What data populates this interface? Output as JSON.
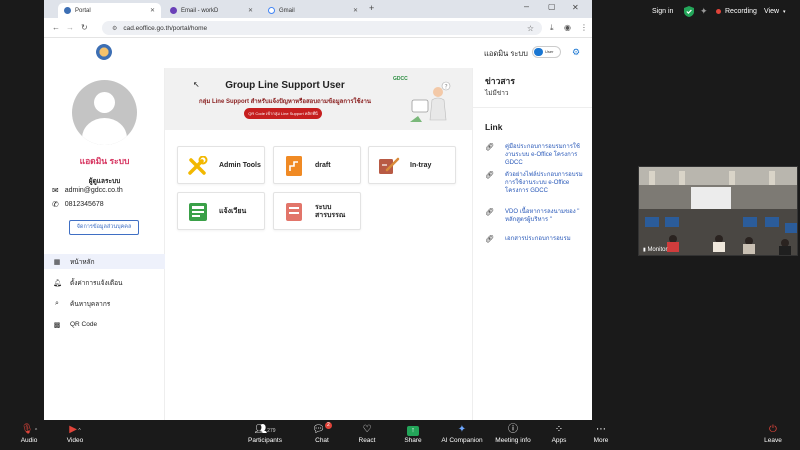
{
  "zoom_top": {
    "sign_in": "Sign in",
    "recording": "Recording",
    "view": "View"
  },
  "browser": {
    "tabs": [
      {
        "label": "Portal",
        "active": true,
        "favicon_color": "#3d6fb4"
      },
      {
        "label": "Email - workD",
        "active": false,
        "favicon_color": "#6a40b8"
      },
      {
        "label": "Gmail",
        "active": false,
        "favicon_color": "#4285f4"
      }
    ],
    "new_tab": "+",
    "url": "cad.eoffice.go.th/portal/home"
  },
  "header": {
    "admin_label": "แอดมิน ระบบ",
    "toggle_label": "User",
    "accent_color": "#1976d2"
  },
  "profile": {
    "name": "แอดมิน ระบบ",
    "role": "ผู้ดูแลระบบ",
    "email": "admin@gdcc.co.th",
    "phone": "0812345678",
    "edit_button": "จัดการข้อมูลส่วนบุคคล"
  },
  "menu": [
    {
      "label": "หน้าหลัก",
      "icon": "grid-icon",
      "active": true
    },
    {
      "label": "ตั้งค่าการแจ้งเตือน",
      "icon": "bell-icon",
      "active": false
    },
    {
      "label": "ค้นหาบุคลากร",
      "icon": "search-icon",
      "active": false
    },
    {
      "label": "QR Code",
      "icon": "qrcode-icon",
      "active": false
    }
  ],
  "banner": {
    "title": "Group Line Support User",
    "subtitle": "กลุ่ม Line Support สำหรับแจ้งปัญหาหรือสอบถามข้อมูลการใช้งาน",
    "button": "QR Code เข้ากลุ่ม Line Support คลิกที่นี่",
    "brand": "GDCC"
  },
  "apps": [
    {
      "label": "Admin Tools",
      "icon": "tools-icon"
    },
    {
      "label": "draft",
      "icon": "draft-icon"
    },
    {
      "label": "In-tray",
      "icon": "intray-icon"
    },
    {
      "label": "แจ้งเวียน",
      "icon": "circular-icon"
    },
    {
      "label": "ระบบ สารบรรณ",
      "icon": "saraban-icon"
    }
  ],
  "news": {
    "heading": "ข่าวสาร",
    "empty": "ไม่มีข่าว"
  },
  "links": {
    "heading": "Link",
    "items": [
      "คู่มือประกอบการอบรมการใช้งานระบบ e-Office โครงการ GDCC",
      "ตัวอย่างไฟล์ประกอบการอบรมการใช้งานระบบ e-Office โครงการ GDCC",
      "VDO เนื้อหาการลงนามของ \" หลักสูตรผู้บริหาร \"",
      "เอกสารประกอบการอบรม"
    ]
  },
  "video": {
    "participant_name": "Monitor"
  },
  "zoom_bottom": {
    "audio": "Audio",
    "video": "Video",
    "participants": "Participants",
    "participants_count": "279",
    "chat": "Chat",
    "chat_badge": "2",
    "react": "React",
    "share": "Share",
    "ai_companion": "AI Companion",
    "meeting_info": "Meeting info",
    "apps": "Apps",
    "more": "More",
    "leave": "Leave"
  }
}
